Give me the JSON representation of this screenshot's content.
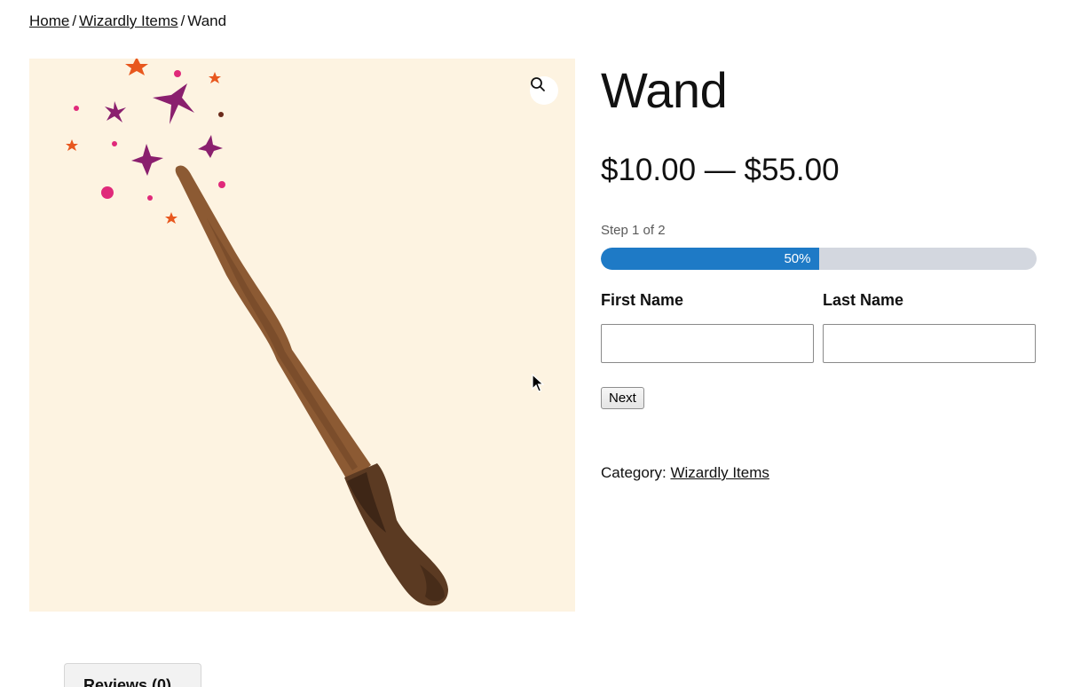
{
  "breadcrumb": {
    "items": [
      {
        "label": "Home"
      },
      {
        "label": "Wizardly Items"
      },
      {
        "label": "Wand"
      }
    ],
    "separator": "/"
  },
  "product": {
    "title": "Wand",
    "price": "$10.00 — $55.00",
    "image_icon": "wand-illustration",
    "zoom_icon": "magnifier-icon"
  },
  "form": {
    "step_label": "Step 1 of 2",
    "progress_percent": 50,
    "progress_text": "50%",
    "first_name_label": "First Name",
    "first_name_value": "",
    "last_name_label": "Last Name",
    "last_name_value": "",
    "next_label": "Next"
  },
  "meta": {
    "category_prefix": "Category:",
    "category_link": "Wizardly Items"
  },
  "tabs": [
    {
      "label": "Reviews (0)"
    }
  ],
  "colors": {
    "image_background": "#fdf3e1",
    "progress_fill": "#1e7ac6",
    "progress_track": "#d3d7df"
  }
}
